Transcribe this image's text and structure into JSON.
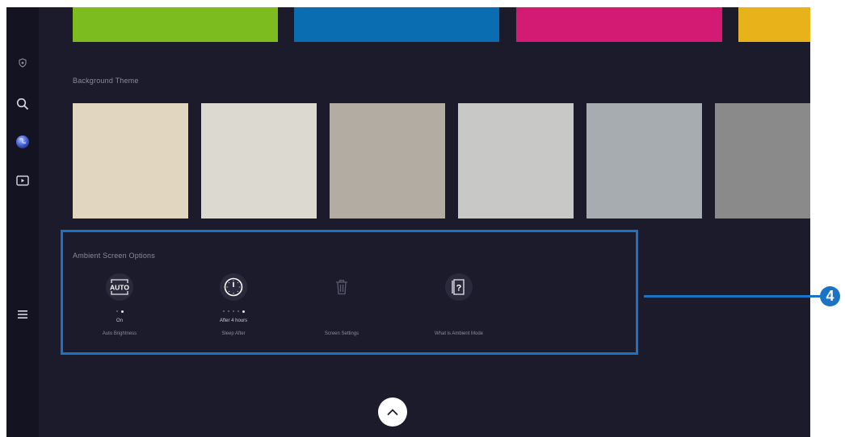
{
  "colors": {
    "accent": "#1a73c5",
    "screen_background": "#1c1b2b",
    "sidebar_background": "#141322"
  },
  "sidebar": {
    "items": [
      {
        "icon": "shield-icon"
      },
      {
        "icon": "search-icon"
      },
      {
        "icon": "ambient-globe-icon"
      },
      {
        "icon": "media-play-icon"
      },
      {
        "icon": "menu-icon"
      }
    ]
  },
  "color_swatches": [
    "#7cbc1f",
    "#0a6db1",
    "#d41b74",
    "#e8b31a"
  ],
  "background_theme": {
    "title": "Background Theme",
    "tiles": [
      "#e1d6bf",
      "#dcd9d1",
      "#b2aca2",
      "#c8c8c7",
      "#a7acb1",
      "#8a8a8a"
    ]
  },
  "ambient_options": {
    "title": "Ambient Screen Options",
    "items": [
      {
        "icon": "auto-brightness-icon",
        "icon_text": "AUTO",
        "value": "On",
        "label": "Auto Brightness",
        "dots": 2,
        "active_dot": 1
      },
      {
        "icon": "sleep-timer-icon",
        "value": "After 4 hours",
        "label": "Sleep After",
        "dots": 5,
        "active_dot": 4
      },
      {
        "icon": "trash-icon",
        "value": "",
        "label": "Screen Settings",
        "dots": 0,
        "active_dot": -1
      },
      {
        "icon": "help-icon",
        "icon_text": "?",
        "value": "",
        "label": "What is Ambient Mode",
        "dots": 0,
        "active_dot": -1
      }
    ]
  },
  "callout": {
    "number": "4"
  },
  "scroll_up": {
    "icon": "chevron-up-icon"
  }
}
